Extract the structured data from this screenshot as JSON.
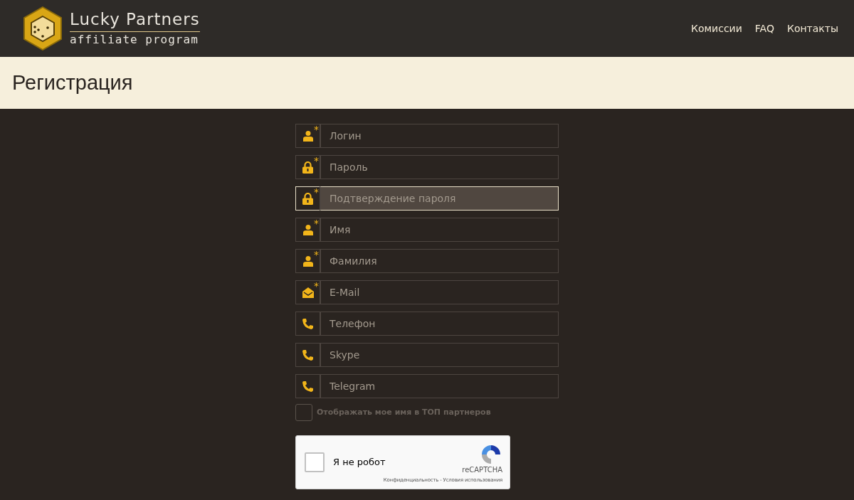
{
  "logo": {
    "title": "Lucky Partners",
    "subtitle": "affiliate program"
  },
  "nav": [
    {
      "label": "Комиссии"
    },
    {
      "label": "FAQ"
    },
    {
      "label": "Контакты"
    }
  ],
  "page_title": "Регистрация",
  "fields": [
    {
      "kind": "user",
      "placeholder": "Логин",
      "required": true,
      "focused": false
    },
    {
      "kind": "lock",
      "placeholder": "Пароль",
      "required": true,
      "focused": false
    },
    {
      "kind": "lock",
      "placeholder": "Подтверждение пароля",
      "required": true,
      "focused": true
    },
    {
      "kind": "user",
      "placeholder": "Имя",
      "required": true,
      "focused": false
    },
    {
      "kind": "user",
      "placeholder": "Фамилия",
      "required": true,
      "focused": false
    },
    {
      "kind": "mail",
      "placeholder": "E-Mail",
      "required": true,
      "focused": false
    },
    {
      "kind": "phone",
      "placeholder": "Телефон",
      "required": false,
      "focused": false
    },
    {
      "kind": "phone",
      "placeholder": "Skype",
      "required": false,
      "focused": false
    },
    {
      "kind": "phone",
      "placeholder": "Telegram",
      "required": false,
      "focused": false
    }
  ],
  "required_mark": "*",
  "top_checkbox": {
    "label": "Отображать мое имя в ТОП партнеров",
    "checked": false
  },
  "captcha": {
    "label": "Я не робот",
    "checked": false,
    "brand": "reCAPTCHA",
    "privacy": "Конфиденциальность",
    "separator": "-",
    "terms": "Условия использования"
  }
}
